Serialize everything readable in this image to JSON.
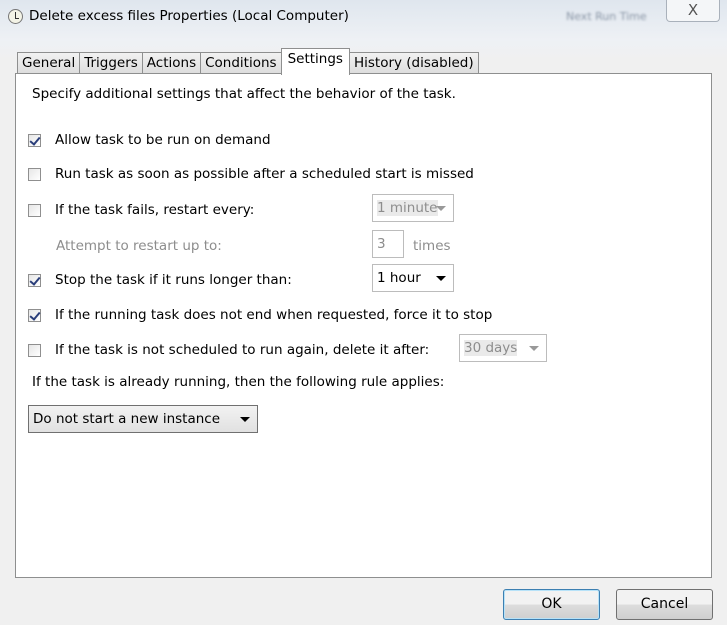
{
  "window": {
    "title": "Delete excess files Properties (Local Computer)",
    "background_text": "Next Run Time",
    "close_label": "X"
  },
  "tabs": [
    {
      "label": "General"
    },
    {
      "label": "Triggers"
    },
    {
      "label": "Actions"
    },
    {
      "label": "Conditions"
    },
    {
      "label": "Settings",
      "active": true
    },
    {
      "label": "History (disabled)"
    }
  ],
  "settings": {
    "description": "Specify additional settings that affect the behavior of the task.",
    "allow_on_demand": {
      "label": "Allow task to be run on demand",
      "checked": true
    },
    "run_asap": {
      "label": "Run task as soon as possible after a scheduled start is missed",
      "checked": false
    },
    "restart": {
      "label": "If the task fails, restart every:",
      "checked": false,
      "value": "1 minute"
    },
    "attempts": {
      "label": "Attempt to restart up to:",
      "value": "3",
      "unit": "times"
    },
    "stop_long": {
      "label": "Stop the task if it runs longer than:",
      "checked": true,
      "value": "1 hour"
    },
    "force_stop": {
      "label": "If the running task does not end when requested, force it to stop",
      "checked": true
    },
    "delete_after": {
      "label": "If the task is not scheduled to run again, delete it after:",
      "checked": false,
      "value": "30 days"
    },
    "rule_label": "If the task is already running, then the following rule applies:",
    "rule_value": "Do not start a new instance"
  },
  "buttons": {
    "ok": "OK",
    "cancel": "Cancel"
  }
}
